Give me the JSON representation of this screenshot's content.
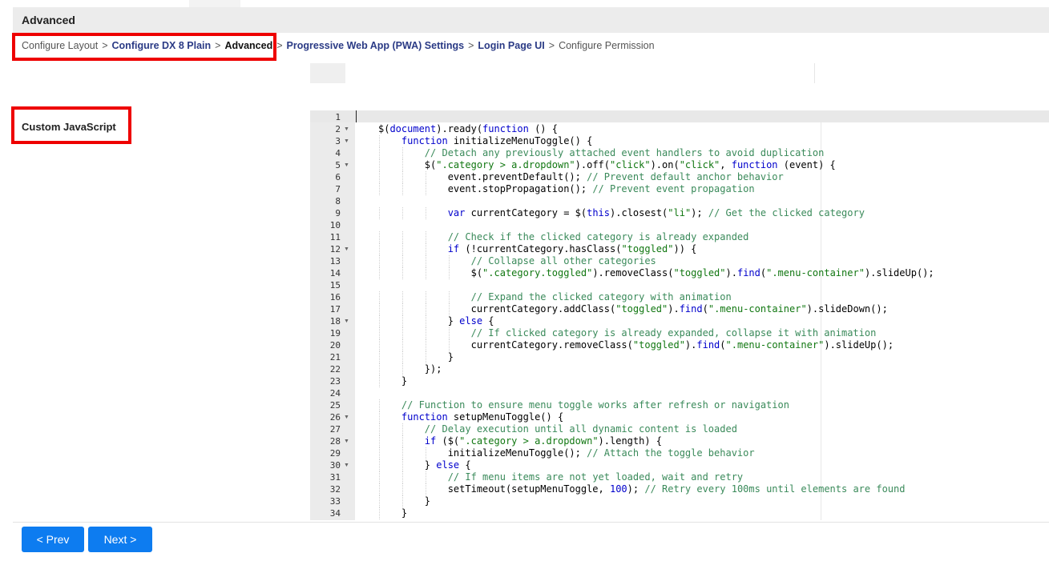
{
  "header": {
    "title": "Advanced"
  },
  "breadcrumb": [
    {
      "label": "Configure Layout",
      "kind": "plain"
    },
    {
      "label": "Configure DX 8 Plain",
      "kind": "link"
    },
    {
      "label": "Advanced",
      "kind": "current"
    },
    {
      "label": "Progressive Web App (PWA) Settings",
      "kind": "link"
    },
    {
      "label": "Login Page UI",
      "kind": "link"
    },
    {
      "label": "Configure Permission",
      "kind": "plain"
    }
  ],
  "breadcrumb_separator": ">",
  "section": {
    "label": "Custom JavaScript"
  },
  "editor": {
    "lines": [
      {
        "n": "1",
        "fold": false,
        "parts": []
      },
      {
        "n": "2",
        "fold": true,
        "parts": [
          [
            "t",
            "$("
          ],
          [
            "kw",
            "document"
          ],
          [
            "t",
            ").ready("
          ],
          [
            "kw",
            "function"
          ],
          [
            "t",
            " () {"
          ]
        ]
      },
      {
        "n": "3",
        "fold": true,
        "parts": [
          [
            "t",
            "    "
          ],
          [
            "kw",
            "function"
          ],
          [
            "t",
            " initializeMenuToggle() {"
          ]
        ]
      },
      {
        "n": "4",
        "fold": false,
        "parts": [
          [
            "t",
            "        "
          ],
          [
            "cm",
            "// Detach any previously attached event handlers to avoid duplication"
          ]
        ]
      },
      {
        "n": "5",
        "fold": true,
        "parts": [
          [
            "t",
            "        $("
          ],
          [
            "st",
            "\".category > a.dropdown\""
          ],
          [
            "t",
            ").off("
          ],
          [
            "st",
            "\"click\""
          ],
          [
            "t",
            ").on("
          ],
          [
            "st",
            "\"click\""
          ],
          [
            "t",
            ", "
          ],
          [
            "kw",
            "function"
          ],
          [
            "t",
            " (event) {"
          ]
        ]
      },
      {
        "n": "6",
        "fold": false,
        "parts": [
          [
            "t",
            "            event.preventDefault(); "
          ],
          [
            "cm",
            "// Prevent default anchor behavior"
          ]
        ]
      },
      {
        "n": "7",
        "fold": false,
        "parts": [
          [
            "t",
            "            event.stopPropagation(); "
          ],
          [
            "cm",
            "// Prevent event propagation"
          ]
        ]
      },
      {
        "n": "8",
        "fold": false,
        "parts": []
      },
      {
        "n": "9",
        "fold": false,
        "parts": [
          [
            "t",
            "            "
          ],
          [
            "kw",
            "var"
          ],
          [
            "t",
            " currentCategory = $("
          ],
          [
            "kw",
            "this"
          ],
          [
            "t",
            ").closest("
          ],
          [
            "st",
            "\"li\""
          ],
          [
            "t",
            "); "
          ],
          [
            "cm",
            "// Get the clicked category"
          ]
        ]
      },
      {
        "n": "10",
        "fold": false,
        "parts": []
      },
      {
        "n": "11",
        "fold": false,
        "parts": [
          [
            "t",
            "            "
          ],
          [
            "cm",
            "// Check if the clicked category is already expanded"
          ]
        ]
      },
      {
        "n": "12",
        "fold": true,
        "parts": [
          [
            "t",
            "            "
          ],
          [
            "kw",
            "if"
          ],
          [
            "t",
            " (!currentCategory.hasClass("
          ],
          [
            "st",
            "\"toggled\""
          ],
          [
            "t",
            ")) {"
          ]
        ]
      },
      {
        "n": "13",
        "fold": false,
        "parts": [
          [
            "t",
            "                "
          ],
          [
            "cm",
            "// Collapse all other categories"
          ]
        ]
      },
      {
        "n": "14",
        "fold": false,
        "parts": [
          [
            "t",
            "                $("
          ],
          [
            "st",
            "\".category.toggled\""
          ],
          [
            "t",
            ").removeClass("
          ],
          [
            "st",
            "\"toggled\""
          ],
          [
            "t",
            ")."
          ],
          [
            "kw",
            "find"
          ],
          [
            "t",
            "("
          ],
          [
            "st",
            "\".menu-container\""
          ],
          [
            "t",
            ").slideUp();"
          ]
        ]
      },
      {
        "n": "15",
        "fold": false,
        "parts": []
      },
      {
        "n": "16",
        "fold": false,
        "parts": [
          [
            "t",
            "                "
          ],
          [
            "cm",
            "// Expand the clicked category with animation"
          ]
        ]
      },
      {
        "n": "17",
        "fold": false,
        "parts": [
          [
            "t",
            "                currentCategory.addClass("
          ],
          [
            "st",
            "\"toggled\""
          ],
          [
            "t",
            ")."
          ],
          [
            "kw",
            "find"
          ],
          [
            "t",
            "("
          ],
          [
            "st",
            "\".menu-container\""
          ],
          [
            "t",
            ").slideDown();"
          ]
        ]
      },
      {
        "n": "18",
        "fold": true,
        "parts": [
          [
            "t",
            "            } "
          ],
          [
            "kw",
            "else"
          ],
          [
            "t",
            " {"
          ]
        ]
      },
      {
        "n": "19",
        "fold": false,
        "parts": [
          [
            "t",
            "                "
          ],
          [
            "cm",
            "// If clicked category is already expanded, collapse it with animation"
          ]
        ]
      },
      {
        "n": "20",
        "fold": false,
        "parts": [
          [
            "t",
            "                currentCategory.removeClass("
          ],
          [
            "st",
            "\"toggled\""
          ],
          [
            "t",
            ")."
          ],
          [
            "kw",
            "find"
          ],
          [
            "t",
            "("
          ],
          [
            "st",
            "\".menu-container\""
          ],
          [
            "t",
            ").slideUp();"
          ]
        ]
      },
      {
        "n": "21",
        "fold": false,
        "parts": [
          [
            "t",
            "            }"
          ]
        ]
      },
      {
        "n": "22",
        "fold": false,
        "parts": [
          [
            "t",
            "        });"
          ]
        ]
      },
      {
        "n": "23",
        "fold": false,
        "parts": [
          [
            "t",
            "    }"
          ]
        ]
      },
      {
        "n": "24",
        "fold": false,
        "parts": []
      },
      {
        "n": "25",
        "fold": false,
        "parts": [
          [
            "t",
            "    "
          ],
          [
            "cm",
            "// Function to ensure menu toggle works after refresh or navigation"
          ]
        ]
      },
      {
        "n": "26",
        "fold": true,
        "parts": [
          [
            "t",
            "    "
          ],
          [
            "kw",
            "function"
          ],
          [
            "t",
            " setupMenuToggle() {"
          ]
        ]
      },
      {
        "n": "27",
        "fold": false,
        "parts": [
          [
            "t",
            "        "
          ],
          [
            "cm",
            "// Delay execution until all dynamic content is loaded"
          ]
        ]
      },
      {
        "n": "28",
        "fold": true,
        "parts": [
          [
            "t",
            "        "
          ],
          [
            "kw",
            "if"
          ],
          [
            "t",
            " ($("
          ],
          [
            "st",
            "\".category > a.dropdown\""
          ],
          [
            "t",
            ").length) {"
          ]
        ]
      },
      {
        "n": "29",
        "fold": false,
        "parts": [
          [
            "t",
            "            initializeMenuToggle(); "
          ],
          [
            "cm",
            "// Attach the toggle behavior"
          ]
        ]
      },
      {
        "n": "30",
        "fold": true,
        "parts": [
          [
            "t",
            "        } "
          ],
          [
            "kw",
            "else"
          ],
          [
            "t",
            " {"
          ]
        ]
      },
      {
        "n": "31",
        "fold": false,
        "parts": [
          [
            "t",
            "            "
          ],
          [
            "cm",
            "// If menu items are not yet loaded, wait and retry"
          ]
        ]
      },
      {
        "n": "32",
        "fold": false,
        "parts": [
          [
            "t",
            "            setTimeout(setupMenuToggle, "
          ],
          [
            "nu",
            "100"
          ],
          [
            "t",
            "); "
          ],
          [
            "cm",
            "// Retry every 100ms until elements are found"
          ]
        ]
      },
      {
        "n": "33",
        "fold": false,
        "parts": [
          [
            "t",
            "        }"
          ]
        ]
      },
      {
        "n": "34",
        "fold": false,
        "parts": [
          [
            "t",
            "    }"
          ]
        ]
      }
    ]
  },
  "nav": {
    "prev_label": "< Prev",
    "next_label": "Next >"
  },
  "colors": {
    "highlight": "#ee0000",
    "button": "#0d7cf0",
    "link": "#2a3a85"
  }
}
